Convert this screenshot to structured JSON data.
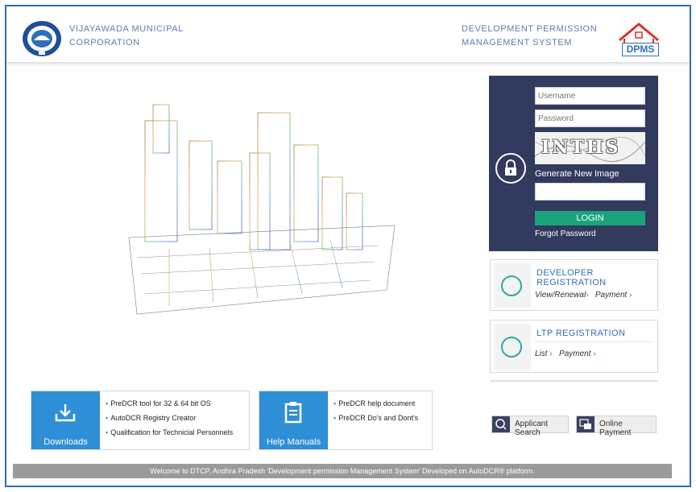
{
  "header": {
    "corp_line1": "VIJAYAWADA MUNICIPAL",
    "corp_line2": "CORPORATION",
    "system_line1": "DEVELOPMENT PERMISSION",
    "system_line2": "MANAGEMENT SYSTEM",
    "dpms_logo_text": "DPMS"
  },
  "login": {
    "username_placeholder": "Username",
    "password_placeholder": "Password",
    "captcha_text": "INTHS",
    "generate_new_image": "Generate New Image",
    "login_button": "LOGIN",
    "forgot_password": "Forgot Password"
  },
  "registrations": {
    "developer": {
      "title": "DEVELOPER REGISTRATION",
      "link1": "View/Renewal",
      "link2": "Payment"
    },
    "ltp": {
      "title": "LTP REGISTRATION",
      "link1": "List",
      "link2": "Payment"
    }
  },
  "bottom_buttons": {
    "applicant_search": "Applicant Search",
    "online_payment": "Online Payment"
  },
  "downloads": {
    "label": "Downloads",
    "items": [
      "PreDCR tool for 32 & 64 bit OS",
      "AutoDCR Registry Creator",
      "Qualification for Technicial Personnels"
    ]
  },
  "help_manuals": {
    "label": "Help Manuals",
    "items": [
      "PreDCR help document",
      "PreDCR Do's and Dont's"
    ]
  },
  "footer": {
    "text": "Welcome to DTCP, Andhra Pradesh 'Development permission Management System' Developed on AutoDCR® platform."
  },
  "colors": {
    "brand_blue": "#2f6fb8",
    "login_panel": "#323a5e",
    "login_button": "#1aa37a",
    "tile_blue": "#2e8fd6"
  }
}
